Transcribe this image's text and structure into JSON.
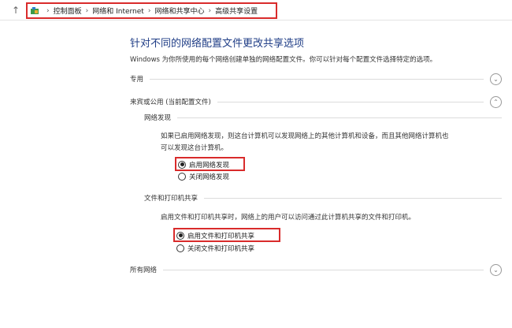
{
  "breadcrumb": {
    "items": [
      "控制面板",
      "网络和 Internet",
      "网络和共享中心",
      "高级共享设置"
    ]
  },
  "page": {
    "title": "针对不同的网络配置文件更改共享选项",
    "description": "Windows 为你所使用的每个网络创建单独的网络配置文件。你可以针对每个配置文件选择特定的选项。"
  },
  "profiles": {
    "private": {
      "label": "专用"
    },
    "guest_public": {
      "label": "来宾或公用 (当前配置文件)"
    },
    "all": {
      "label": "所有网络"
    }
  },
  "network_discovery": {
    "heading": "网络发现",
    "description_line1": "如果已启用网络发现，则这台计算机可以发现网络上的其他计算机和设备，而且其他网络计算机也",
    "description_line2": "可以发现这台计算机。",
    "option_on": "启用网络发现",
    "option_off": "关闭网络发现",
    "selected": "on"
  },
  "file_printer_sharing": {
    "heading": "文件和打印机共享",
    "description": "启用文件和打印机共享时，网络上的用户可以访问通过此计算机共享的文件和打印机。",
    "option_on": "启用文件和打印机共享",
    "option_off": "关闭文件和打印机共享",
    "selected": "on"
  },
  "icons": {
    "nav": "up-arrow-icon",
    "folder": "control-panel-icon",
    "expand": "chevron-down-icon",
    "collapse": "chevron-up-icon"
  },
  "colors": {
    "title": "#1f3d86",
    "highlight": "#d92b2b"
  }
}
